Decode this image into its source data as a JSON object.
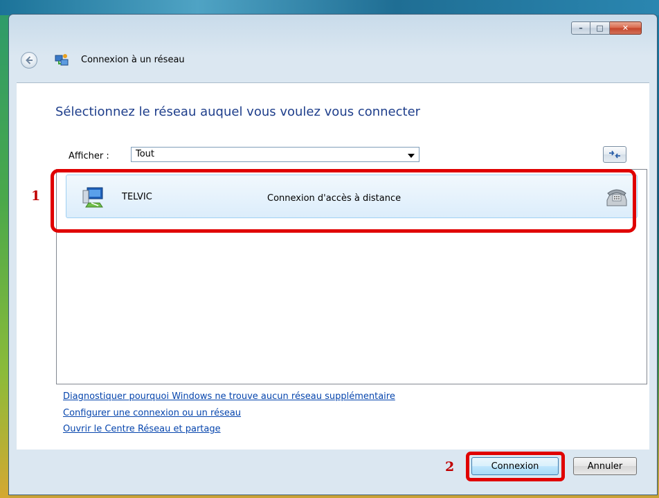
{
  "window": {
    "title": "Connexion à un réseau",
    "caption_buttons": {
      "minimize": "–",
      "maximize": "□",
      "close": "✕"
    }
  },
  "content": {
    "heading": "Sélectionnez le réseau auquel vous voulez vous connecter",
    "show_label": "Afficher :",
    "show_value": "Tout",
    "refresh_icon": "refresh-icon"
  },
  "networks": [
    {
      "name": "TELVIC",
      "type": "Connexion d'accès à distance",
      "icon": "network-icon",
      "status_icon": "phone-icon"
    }
  ],
  "links": {
    "diagnose": "Diagnostiquer pourquoi Windows ne trouve aucun réseau supplémentaire",
    "configure": "Configurer une connexion ou un réseau",
    "network_center": "Ouvrir le Centre Réseau et partage"
  },
  "buttons": {
    "connect": "Connexion",
    "cancel": "Annuler"
  },
  "annotations": {
    "marker_1": "1",
    "marker_2": "2",
    "highlight_color": "#e00000"
  },
  "colors": {
    "heading": "#1e3e8b",
    "link": "#0645ad"
  }
}
